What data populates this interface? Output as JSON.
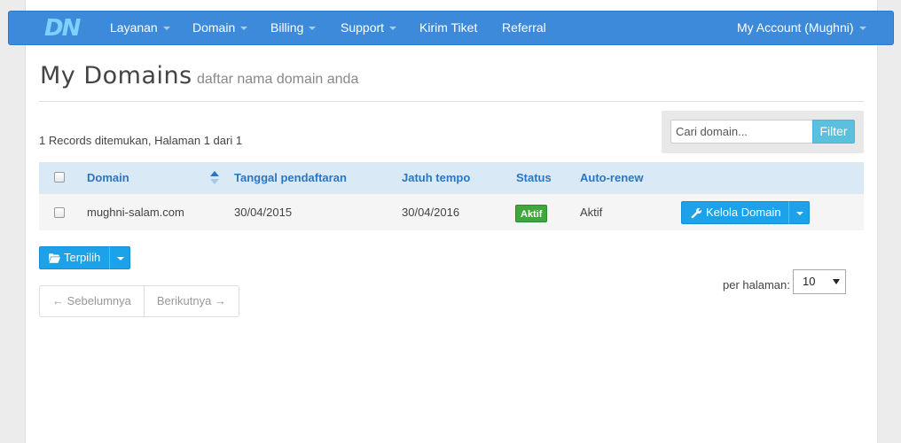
{
  "brand": {
    "logo_text": "DN"
  },
  "nav": {
    "items": [
      {
        "label": "Layanan",
        "dropdown": true
      },
      {
        "label": "Domain",
        "dropdown": true
      },
      {
        "label": "Billing",
        "dropdown": true
      },
      {
        "label": "Support",
        "dropdown": true
      },
      {
        "label": "Kirim Tiket",
        "dropdown": false
      },
      {
        "label": "Referral",
        "dropdown": false
      }
    ],
    "account": {
      "label": "My Account (Mughni)",
      "dropdown": true
    }
  },
  "page": {
    "title": "My Domains",
    "subtitle": "daftar nama domain anda"
  },
  "records_text": "1 Records ditemukan, Halaman 1 dari 1",
  "search": {
    "placeholder": "Cari domain...",
    "value": "",
    "button_label": "Filter"
  },
  "table": {
    "headers": {
      "domain": "Domain",
      "registered": "Tanggal pendaftaran",
      "due": "Jatuh tempo",
      "status": "Status",
      "autorenew": "Auto-renew"
    },
    "sort_column": "domain",
    "sort_direction": "ascending",
    "rows": [
      {
        "checked": false,
        "domain": "mughni-salam.com",
        "registered": "30/04/2015",
        "due": "30/04/2016",
        "status": "Aktif",
        "autorenew": "Aktif",
        "action_label": "Kelola Domain"
      }
    ]
  },
  "bulk": {
    "label": "Terpilih"
  },
  "pagination": {
    "prev": "← Sebelumnya",
    "next": "Berikutnya →"
  },
  "per_page": {
    "label": "per halaman:",
    "value": "10"
  },
  "colors": {
    "navbar": "#3c8ad9",
    "primary_button": "#1da1e8",
    "filter_button": "#5bc0de",
    "status_badge": "#3fa73b",
    "link": "#2a76c6",
    "table_header_bg": "#d9e9f5"
  },
  "icons": {
    "kelola": "wrench-icon",
    "terpilih": "folder-open-icon"
  }
}
